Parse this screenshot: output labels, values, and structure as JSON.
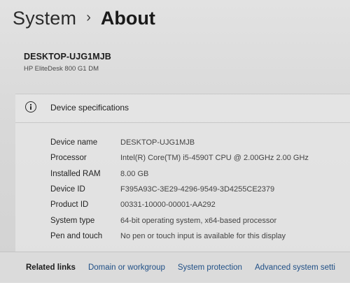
{
  "breadcrumb": {
    "parent": "System",
    "separator": "›",
    "current": "About"
  },
  "device": {
    "name": "DESKTOP-UJG1MJB",
    "model": "HP EliteDesk 800 G1 DM"
  },
  "specifications": {
    "title": "Device specifications",
    "rows": [
      {
        "label": "Device name",
        "value": "DESKTOP-UJG1MJB"
      },
      {
        "label": "Processor",
        "value": "Intel(R) Core(TM) i5-4590T CPU @ 2.00GHz   2.00 GHz"
      },
      {
        "label": "Installed RAM",
        "value": "8.00 GB"
      },
      {
        "label": "Device ID",
        "value": "F395A93C-3E29-4296-9549-3D4255CE2379"
      },
      {
        "label": "Product ID",
        "value": "00331-10000-00001-AA292"
      },
      {
        "label": "System type",
        "value": "64-bit operating system, x64-based processor"
      },
      {
        "label": "Pen and touch",
        "value": "No pen or touch input is available for this display"
      }
    ]
  },
  "related_links": {
    "title": "Related links",
    "links": [
      "Domain or workgroup",
      "System protection",
      "Advanced system setti"
    ]
  }
}
